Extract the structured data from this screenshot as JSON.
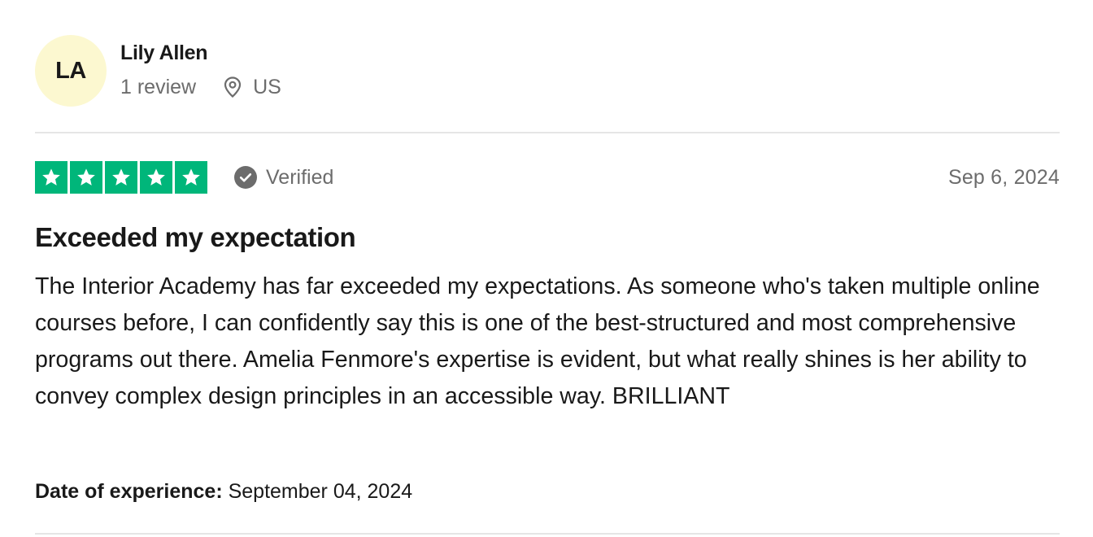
{
  "consumer": {
    "initials": "LA",
    "name": "Lily Allen",
    "review_count": "1 review",
    "location": "US",
    "location_icon": "location-pin-icon",
    "avatar_color": "#fcf8d0"
  },
  "rating": {
    "stars": 5,
    "max_stars": 5,
    "star_color": "#00b67a",
    "star_icon": "star-icon",
    "verified_label": "Verified",
    "verified_icon": "check-circle-icon"
  },
  "review": {
    "date": "Sep 6, 2024",
    "title": "Exceeded my expectation",
    "text": "The Interior Academy has far exceeded my expectations. As someone who's taken multiple online courses before, I can confidently say this is one of the best-structured and most comprehensive programs out there. Amelia Fenmore's expertise is evident, but what really shines is her ability to convey complex design principles in an accessible way. BRILLIANT",
    "experience_label": "Date of experience:",
    "experience_date": "September 04, 2024"
  }
}
